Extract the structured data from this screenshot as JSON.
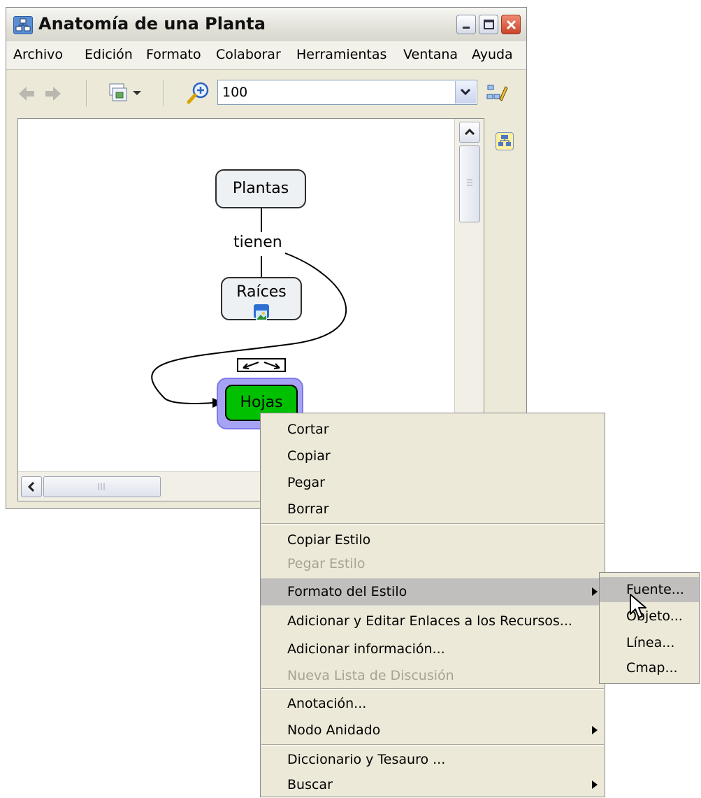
{
  "window": {
    "title": "Anatomía de una Planta"
  },
  "menubar": [
    "Archivo",
    "Edición",
    "Formato",
    "Colaborar",
    "Herramientas",
    "Ventana",
    "Ayuda"
  ],
  "toolbar": {
    "zoom_value": "100"
  },
  "concept_map": {
    "concepts": [
      "Plantas",
      "Raíces",
      "Hojas"
    ],
    "link_phrase": "tienen"
  },
  "context_menu": {
    "items": [
      {
        "label": "Cortar",
        "enabled": true
      },
      {
        "label": "Copiar",
        "enabled": true
      },
      {
        "label": "Pegar",
        "enabled": true
      },
      {
        "label": "Borrar",
        "enabled": true
      },
      {
        "label": "Copiar Estilo",
        "enabled": true
      },
      {
        "label": "Pegar Estilo",
        "enabled": false
      },
      {
        "label": "Formato del Estilo",
        "enabled": true,
        "submenu": true,
        "highlighted": true
      },
      {
        "label": "Adicionar y Editar Enlaces a los Recursos...",
        "enabled": true
      },
      {
        "label": "Adicionar información...",
        "enabled": true
      },
      {
        "label": "Nueva Lista de Discusión",
        "enabled": false
      },
      {
        "label": "Anotación...",
        "enabled": true
      },
      {
        "label": "Nodo Anidado",
        "enabled": true,
        "submenu": true
      },
      {
        "label": "Diccionario y Tesauro ...",
        "enabled": true
      },
      {
        "label": "Buscar",
        "enabled": true,
        "submenu": true
      }
    ]
  },
  "submenu": {
    "items": [
      "Fuente...",
      "Objeto...",
      "Línea...",
      "Cmap..."
    ]
  },
  "colors": {
    "selected_node_fill": "#00c000",
    "selection_halo": "#a6a3f5",
    "menu_highlight": "#c0bfbd",
    "disabled_text": "#a6a392"
  }
}
